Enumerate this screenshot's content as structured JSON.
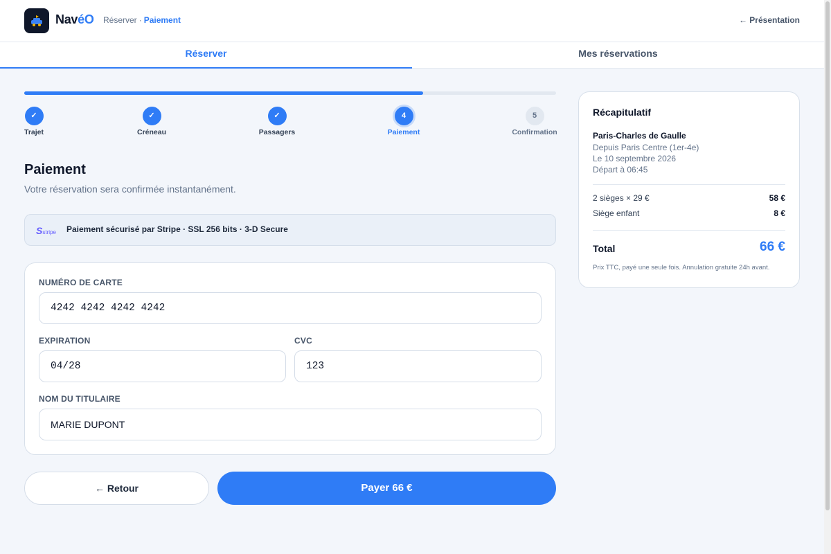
{
  "header": {
    "brand_part1": "Nav",
    "brand_part2": "éO",
    "breadcrumb": [
      "Réserver",
      "Paiement"
    ],
    "breadcrumb_sep": "·",
    "back_link": "← Présentation"
  },
  "tabs": [
    {
      "label": "Réserver",
      "active": true
    },
    {
      "label": "Mes réservations",
      "active": false
    }
  ],
  "progress": {
    "value_fraction": 0.75
  },
  "steps": [
    {
      "label": "Trajet",
      "status": "done",
      "mark": "✓"
    },
    {
      "label": "Créneau",
      "status": "done",
      "mark": "✓"
    },
    {
      "label": "Passagers",
      "status": "done",
      "mark": "✓"
    },
    {
      "label": "Paiement",
      "status": "active",
      "mark": "4"
    },
    {
      "label": "Confirmation",
      "status": "todo",
      "mark": "5"
    }
  ],
  "main": {
    "title": "Paiement",
    "subtitle": "Votre réservation sera confirmée instantanément.",
    "secure_logo": "S",
    "secure_logo_word": "stripe",
    "secure_text": "Paiement sécurisé par Stripe · SSL 256 bits · 3-D Secure"
  },
  "form": {
    "card_number_label": "NUMÉRO DE CARTE",
    "card_number_value": "4242 4242 4242 4242",
    "expiry_label": "EXPIRATION",
    "expiry_value": "04/28",
    "cvc_label": "CVC",
    "cvc_value": "123",
    "holder_label": "NOM DU TITULAIRE",
    "holder_value": "MARIE DUPONT"
  },
  "buttons": {
    "back": "← Retour",
    "pay": "Payer 66 €"
  },
  "summary": {
    "title": "Récapitulatif",
    "destination": "Paris-Charles de Gaulle",
    "origin": "Depuis Paris Centre (1er-4e)",
    "date": "Le 10 septembre 2026",
    "departure": "Départ à 06:45",
    "lines": [
      {
        "label": "2 sièges × 29 €",
        "value": "58 €"
      },
      {
        "label": "Siège enfant",
        "value": "8 €"
      }
    ],
    "total_label": "Total",
    "total_value": "66 €",
    "note": "Prix TTC, payé une seule fois. Annulation gratuite 24h avant."
  },
  "colors": {
    "accent": "#2f7cf6",
    "dark": "#0f172a",
    "background": "#f3f6fb"
  },
  "icons": {
    "logo": "car-icon",
    "stripe": "stripe-logo"
  }
}
